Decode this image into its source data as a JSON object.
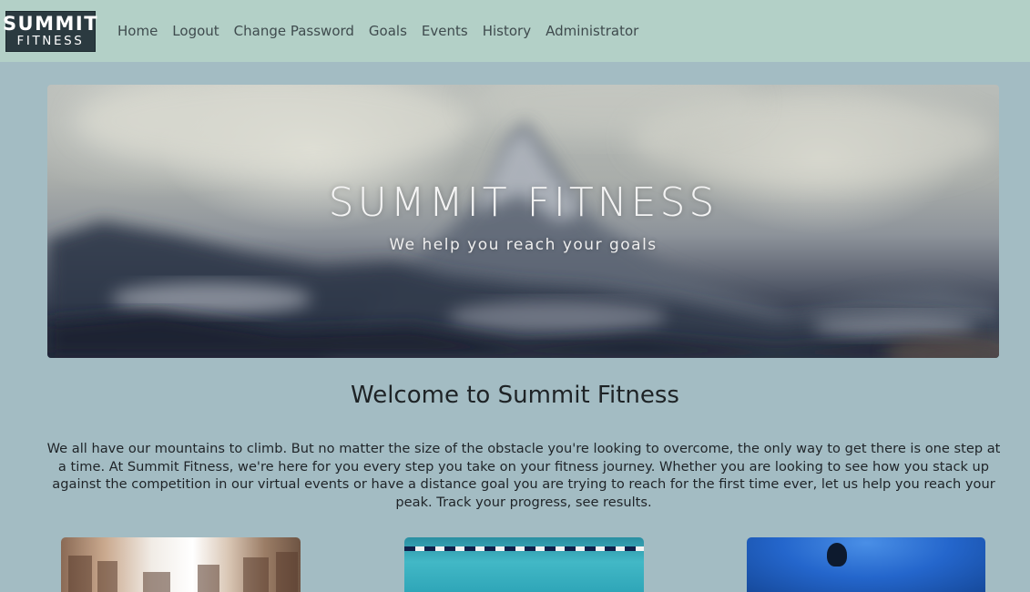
{
  "navbar": {
    "logo": {
      "line1": "SUMMIT",
      "line2": "FITNESS"
    },
    "links": [
      {
        "label": "Home"
      },
      {
        "label": "Logout"
      },
      {
        "label": "Change Password"
      },
      {
        "label": "Goals"
      },
      {
        "label": "Events"
      },
      {
        "label": "History"
      },
      {
        "label": "Administrator"
      }
    ]
  },
  "hero": {
    "title": "SUMMIT FITNESS",
    "subtitle": "We help you reach your goals"
  },
  "welcome": {
    "title": "Welcome to Summit Fitness",
    "body": "We all have our mountains to climb. But no matter the size of the obstacle you're looking to overcome, the only way to get there is one step at a time. At Summit Fitness, we're here for you every step you take on your fitness journey. Whether you are looking to see how you stack up against the competition in our virtual events or have a distance goal you are trying to reach for the first time ever, let us help you reach your peak. Track your progress, see results."
  },
  "colors": {
    "navbar_bg": "#b3d0c7",
    "page_bg": "#a3bcc3",
    "logo_bg": "#2b3a40",
    "nav_text": "#3f4b4e"
  }
}
